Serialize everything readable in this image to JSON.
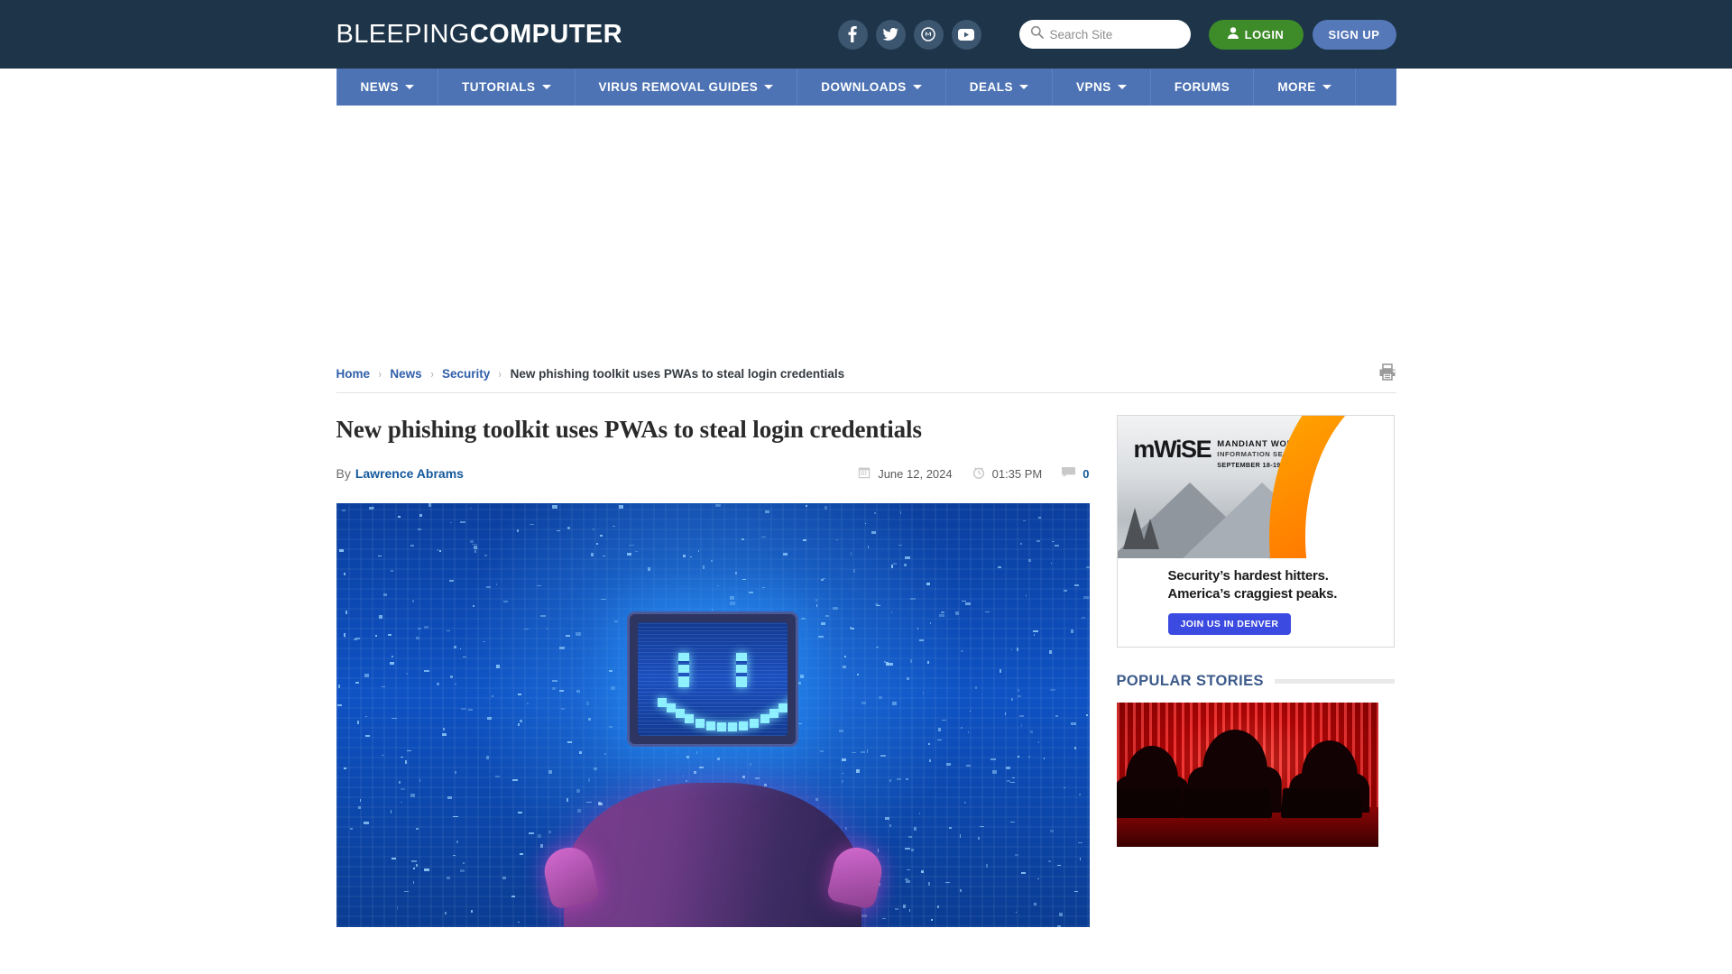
{
  "header": {
    "logo_thin": "BLEEPING",
    "logo_bold": "COMPUTER",
    "social": [
      {
        "name": "facebook-icon",
        "label": "Facebook"
      },
      {
        "name": "twitter-icon",
        "label": "Twitter"
      },
      {
        "name": "mastodon-icon",
        "label": "Mastodon"
      },
      {
        "name": "youtube-icon",
        "label": "YouTube"
      }
    ],
    "search": {
      "placeholder": "Search Site",
      "value": "",
      "icon": "search-icon"
    },
    "login_label": "LOGIN",
    "signup_label": "SIGN UP",
    "login_color": "#3e8b29",
    "signup_color": "#5578b8",
    "background": "#1d3449"
  },
  "nav": {
    "background": "#4d73b4",
    "items": [
      {
        "label": "NEWS",
        "has_dropdown": true
      },
      {
        "label": "TUTORIALS",
        "has_dropdown": true
      },
      {
        "label": "VIRUS REMOVAL GUIDES",
        "has_dropdown": true
      },
      {
        "label": "DOWNLOADS",
        "has_dropdown": true
      },
      {
        "label": "DEALS",
        "has_dropdown": true
      },
      {
        "label": "VPNS",
        "has_dropdown": true
      },
      {
        "label": "FORUMS",
        "has_dropdown": false
      },
      {
        "label": "MORE",
        "has_dropdown": true
      }
    ]
  },
  "breadcrumb": {
    "items": [
      {
        "label": "Home",
        "link": true
      },
      {
        "label": "News",
        "link": true
      },
      {
        "label": "Security",
        "link": true
      },
      {
        "label": "New phishing toolkit uses PWAs to steal login credentials",
        "link": false
      }
    ],
    "separator": "›",
    "print_icon": "printer-icon"
  },
  "article": {
    "title": "New phishing toolkit uses PWAs to steal login credentials",
    "by_label": "By",
    "author": "Lawrence Abrams",
    "date": "June 12, 2024",
    "date_icon": "calendar-icon",
    "time": "01:35 PM",
    "time_icon": "clock-icon",
    "comment_count": "0",
    "comment_icon": "comment-icon",
    "hero_alt": "Monitor-headed figure with smiley face in a blue digital city"
  },
  "sidebar": {
    "ad": {
      "logo": "mWiSE",
      "line1": "MANDIANT WORLDWIDE",
      "line2": "INFORMATION SECURITY EXCHANGE",
      "line3": "SEPTEMBER 18-19, 2024 | DENVER, CO",
      "headline_1": "Security’s hardest hitters.",
      "headline_2": "America’s craggiest peaks.",
      "cta": "JOIN US IN DENVER",
      "cta_color": "#3b4ae0"
    },
    "popular": {
      "title": "POPULAR STORIES",
      "title_color": "#3c5a8a",
      "thumb_alt": "Three hooded figures at laptops on a red background"
    }
  }
}
